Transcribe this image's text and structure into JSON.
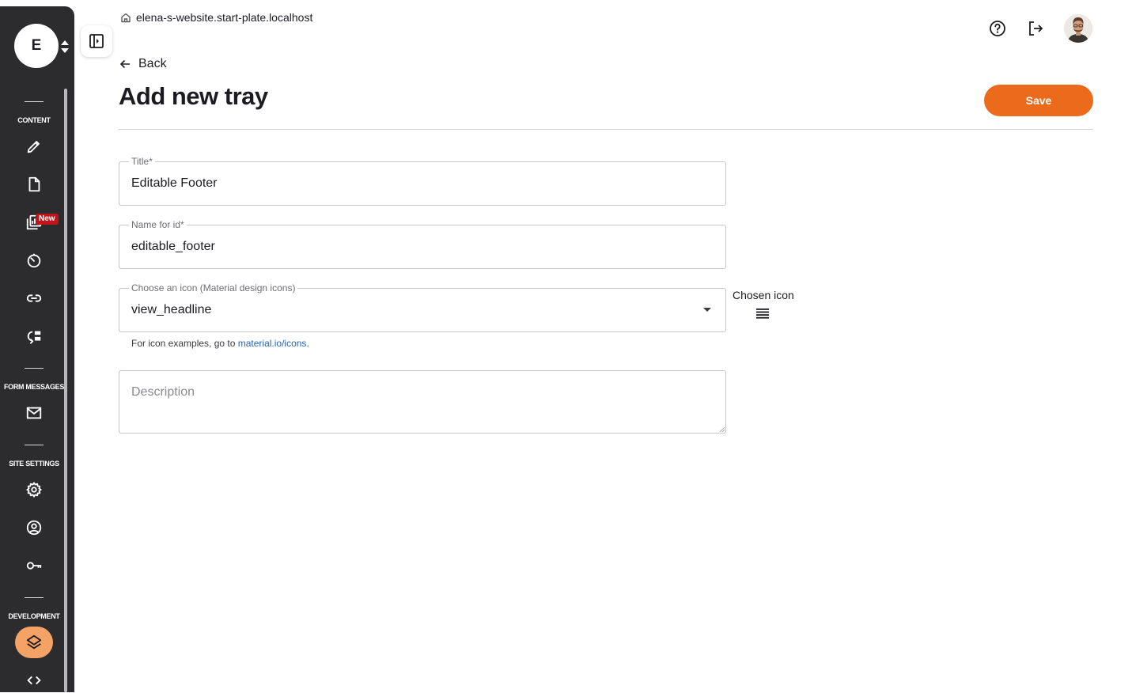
{
  "sidebar": {
    "site_initial": "E",
    "sections": [
      {
        "label": "CONTENT"
      },
      {
        "label": "FORM MESSAGES"
      },
      {
        "label": "SITE SETTINGS"
      },
      {
        "label": "DEVELOPMENT"
      }
    ],
    "new_badge": "New",
    "active_color": "#f4a266"
  },
  "header": {
    "site_host": "elena-s-website.start-plate.localhost",
    "back_label": "Back",
    "page_title": "Add new tray",
    "save_label": "Save"
  },
  "form": {
    "title": {
      "label": "Title*",
      "value": "Editable Footer"
    },
    "name_for_id": {
      "label": "Name for id*",
      "value": "editable_footer"
    },
    "icon": {
      "label": "Choose an icon (Material design icons)",
      "value": "view_headline"
    },
    "helper_prefix": "For icon examples, go to ",
    "helper_link": "material.io/icons",
    "helper_suffix": ".",
    "chosen_icon_label": "Chosen icon",
    "description": {
      "placeholder": "Description"
    }
  },
  "colors": {
    "accent": "#ec6a1c",
    "sidebar_bg": "#2c2c2e",
    "link": "#2864b4",
    "badge": "#c4121b"
  }
}
